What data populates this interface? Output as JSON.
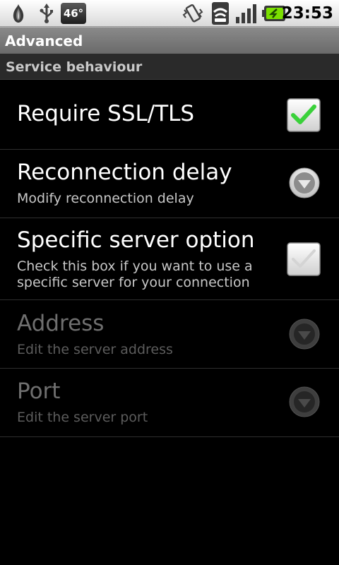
{
  "status_bar": {
    "temperature": "46°",
    "time": "23:53",
    "icons": [
      "tor-onion-icon",
      "usb-icon",
      "vibrate-icon",
      "wifi-icon",
      "signal-icon",
      "battery-charging-icon"
    ]
  },
  "title_bar": {
    "title": "Advanced"
  },
  "category": {
    "title": "Service behaviour"
  },
  "prefs": [
    {
      "title": "Require SSL/TLS",
      "summary": "",
      "widget": "checkbox",
      "checked": true,
      "enabled": true
    },
    {
      "title": "Reconnection delay",
      "summary": "Modify reconnection delay",
      "widget": "dropdown",
      "enabled": true
    },
    {
      "title": "Specific server option",
      "summary": "Check this box if you want to use a specific server for your connection",
      "widget": "checkbox",
      "checked": false,
      "enabled": true
    },
    {
      "title": "Address",
      "summary": "Edit the server address",
      "widget": "dropdown",
      "enabled": false
    },
    {
      "title": "Port",
      "summary": "Edit the server port",
      "widget": "dropdown",
      "enabled": false
    }
  ],
  "colors": {
    "check_green": "#3ad13a",
    "background": "#000000",
    "category_bg": "#2a2a2a",
    "title_bar": "#7a7a7a"
  }
}
